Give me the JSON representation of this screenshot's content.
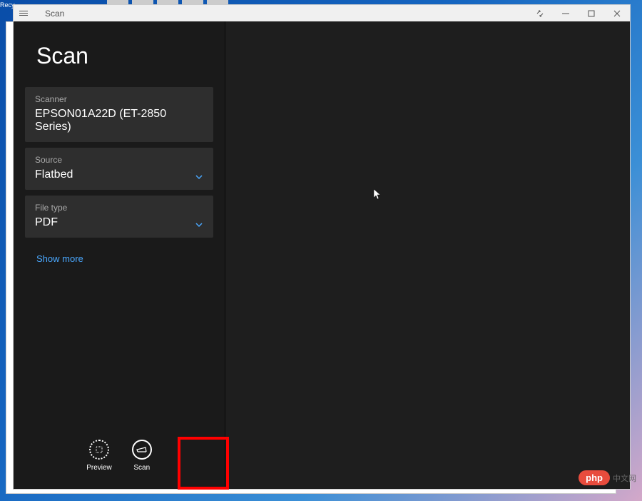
{
  "app": {
    "title": "Scan"
  },
  "page": {
    "title": "Scan"
  },
  "desktop": {
    "recycle_label": "Recy..."
  },
  "settings": {
    "scanner": {
      "label": "Scanner",
      "value": "EPSON01A22D (ET-2850 Series)"
    },
    "source": {
      "label": "Source",
      "value": "Flatbed"
    },
    "filetype": {
      "label": "File type",
      "value": "PDF"
    },
    "show_more": "Show more"
  },
  "actions": {
    "preview": "Preview",
    "scan": "Scan"
  },
  "watermark": {
    "bubble": "php",
    "text": "中文网"
  }
}
